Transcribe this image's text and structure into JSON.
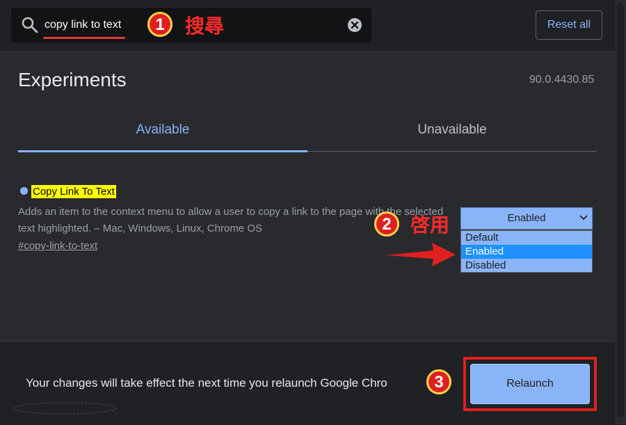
{
  "search": {
    "value": "copy link to text",
    "clear_icon": "clear-circle-icon",
    "search_icon": "magnifier-icon"
  },
  "header": {
    "reset_label": "Reset all"
  },
  "page": {
    "title": "Experiments",
    "version": "90.0.4430.85"
  },
  "tabs": [
    {
      "label": "Available",
      "active": true
    },
    {
      "label": "Unavailable",
      "active": false
    }
  ],
  "flag": {
    "title": "Copy Link To Text",
    "description": "Adds an item to the context menu to allow a user to copy a link to the page with the selected text highlighted. – Mac, Windows, Linux, Chrome OS",
    "link": "#copy-link-to-text",
    "selected_value": "Enabled",
    "options": [
      "Default",
      "Enabled",
      "Disabled"
    ]
  },
  "annotations": {
    "step1_number": "1",
    "step1_label": "搜尋",
    "step2_number": "2",
    "step2_label": "啓用",
    "step3_number": "3"
  },
  "footer": {
    "message": "Your changes will take effect the next time you relaunch Google Chro",
    "relaunch_label": "Relaunch"
  },
  "colors": {
    "accent": "#8ab4f8",
    "background": "#202124",
    "panel": "#292a2d",
    "annotation_red": "#e02020",
    "highlight_yellow": "#ffff00"
  }
}
